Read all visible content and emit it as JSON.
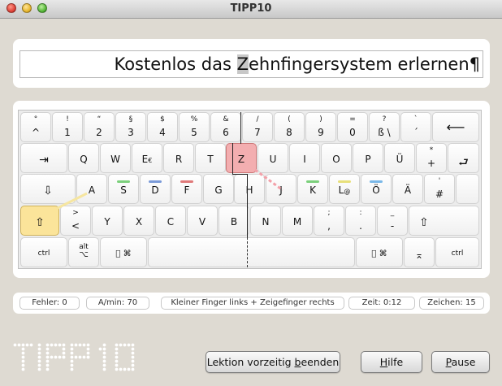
{
  "window": {
    "title": "TIPP10"
  },
  "lesson": {
    "text_before": "Kostenlos das ",
    "text_current": "Z",
    "text_after": "ehnfingersystem erlernen¶"
  },
  "keyboard": {
    "row1": [
      {
        "top": "°",
        "bottom": "^"
      },
      {
        "top": "!",
        "bottom": "1"
      },
      {
        "top": "“",
        "bottom": "2"
      },
      {
        "top": "§",
        "bottom": "3"
      },
      {
        "top": "$",
        "bottom": "4"
      },
      {
        "top": "%",
        "bottom": "5"
      },
      {
        "top": "&",
        "bottom": "6"
      },
      {
        "top": "/",
        "bottom": "7"
      },
      {
        "top": "(",
        "bottom": "8"
      },
      {
        "top": ")",
        "bottom": "9"
      },
      {
        "top": "=",
        "bottom": "0"
      },
      {
        "top": "?",
        "bottom": "ß \\"
      },
      {
        "top": "`",
        "bottom": "´"
      },
      {
        "label": "⟵"
      }
    ],
    "row2": [
      {
        "label": "⇥"
      },
      {
        "label": "Q"
      },
      {
        "label": "W"
      },
      {
        "label": "E",
        "sub": "€"
      },
      {
        "label": "R"
      },
      {
        "label": "T"
      },
      {
        "label": "Z"
      },
      {
        "label": "U"
      },
      {
        "label": "I"
      },
      {
        "label": "O"
      },
      {
        "label": "P"
      },
      {
        "label": "Ü"
      },
      {
        "top": "*",
        "bottom": "+"
      },
      {
        "label": "⮐"
      }
    ],
    "row3": [
      {
        "label": "⇩"
      },
      {
        "label": "A"
      },
      {
        "label": "S"
      },
      {
        "label": "D"
      },
      {
        "label": "F"
      },
      {
        "label": "G"
      },
      {
        "label": "H"
      },
      {
        "label": "J"
      },
      {
        "label": "K"
      },
      {
        "label": "L",
        "sub": "@"
      },
      {
        "label": "Ö"
      },
      {
        "label": "Ä"
      },
      {
        "top": "'",
        "bottom": "#"
      }
    ],
    "row4": [
      {
        "label": "⇧"
      },
      {
        "top": ">",
        "bottom": "<"
      },
      {
        "label": "Y"
      },
      {
        "label": "X"
      },
      {
        "label": "C"
      },
      {
        "label": "V"
      },
      {
        "label": "B"
      },
      {
        "label": "N"
      },
      {
        "label": "M"
      },
      {
        "top": ";",
        "bottom": ","
      },
      {
        "top": ":",
        "bottom": "."
      },
      {
        "top": "_",
        "bottom": "-"
      },
      {
        "label": "⇧"
      }
    ],
    "row5": [
      {
        "label": "ctrl"
      },
      {
        "top": "alt",
        "bottom": "⌥"
      },
      {
        "label": " ⌘"
      },
      {
        "label": ""
      },
      {
        "label": " ⌘"
      },
      {
        "label": "⌅"
      },
      {
        "label": "ctrl"
      }
    ],
    "finger_colors": {
      "s": "#7cd07c",
      "d": "#7a9ad8",
      "f": "#e07a7a",
      "l": "#e8e07a",
      "o": "#7ab8e8"
    },
    "highlight_red": "#f3aeb0",
    "highlight_yellow": "#fbe49a"
  },
  "status": {
    "errors": "Fehler: 0",
    "rate": "A/min: 70",
    "hint": "Kleiner Finger links + Zeigefinger rechts",
    "time": "Zeit: 0:12",
    "chars": "Zeichen: 15"
  },
  "buttons": {
    "end_lesson_pre": "Lektion vorzeitig ",
    "end_lesson_u": "b",
    "end_lesson_post": "eenden",
    "help_u": "H",
    "help_post": "ilfe",
    "pause_u": "P",
    "pause_post": "ause"
  }
}
